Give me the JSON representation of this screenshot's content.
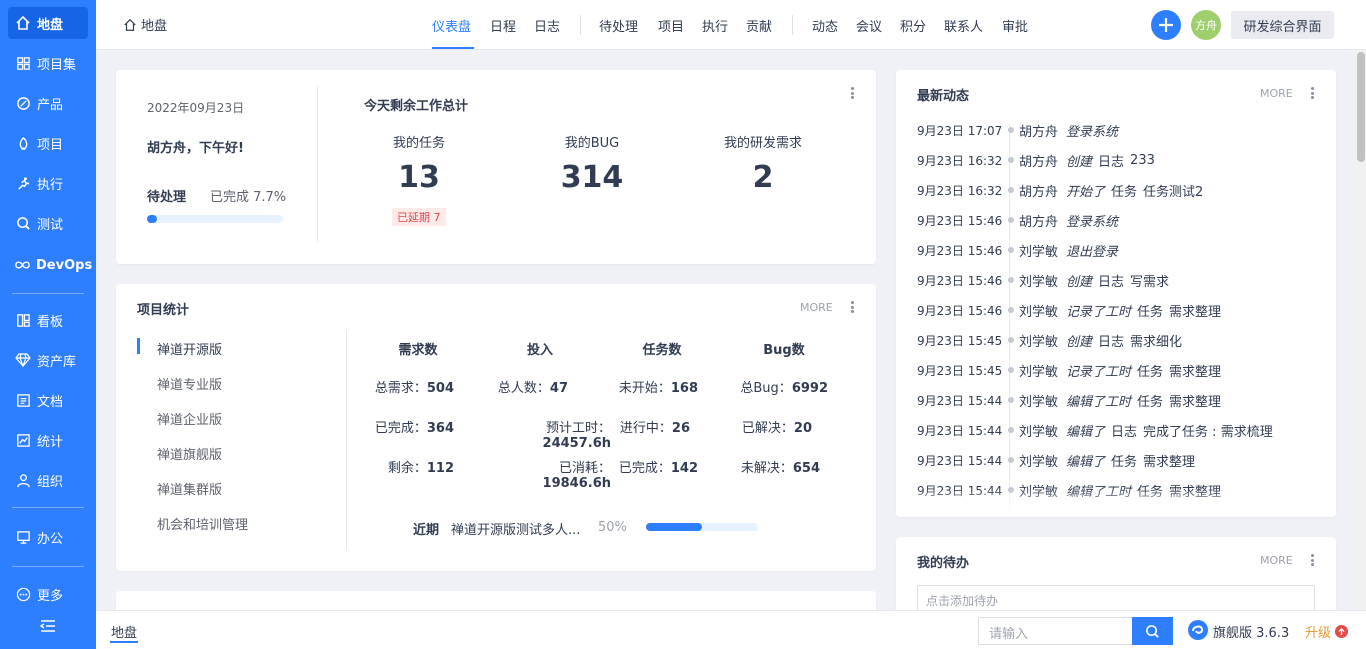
{
  "sidebar": {
    "items": [
      {
        "label": "地盘",
        "icon": "home-icon"
      },
      {
        "label": "项目集",
        "icon": "grid-icon"
      },
      {
        "label": "产品",
        "icon": "product-icon"
      },
      {
        "label": "项目",
        "icon": "project-icon"
      },
      {
        "label": "执行",
        "icon": "run-icon"
      },
      {
        "label": "测试",
        "icon": "test-icon"
      },
      {
        "label": "DevOps",
        "icon": "infinity-icon"
      },
      {
        "label": "看板",
        "icon": "kanban-icon"
      },
      {
        "label": "资产库",
        "icon": "diamond-icon"
      },
      {
        "label": "文档",
        "icon": "doc-icon"
      },
      {
        "label": "统计",
        "icon": "chart-icon"
      },
      {
        "label": "组织",
        "icon": "user-icon"
      },
      {
        "label": "办公",
        "icon": "office-icon"
      },
      {
        "label": "更多",
        "icon": "more-icon"
      }
    ]
  },
  "header": {
    "crumb": "地盘",
    "nav": [
      "仪表盘",
      "日程",
      "日志",
      "待处理",
      "项目",
      "执行",
      "贡献",
      "动态",
      "会议",
      "积分",
      "联系人",
      "审批"
    ],
    "avatar": "方舟",
    "ui_switch": "研发综合界面"
  },
  "welcome": {
    "date": "2022年09月23日",
    "greeting": "胡方舟，下午好!",
    "pending_label": "待处理",
    "done_label": "已完成 7.7%",
    "progress": 0.077,
    "summary_title": "今天剩余工作总计",
    "stats": [
      {
        "label": "我的任务",
        "value": "13"
      },
      {
        "label": "我的BUG",
        "value": "314"
      },
      {
        "label": "我的研发需求",
        "value": "2"
      }
    ],
    "delayed": "已延期 7"
  },
  "project_stats": {
    "title": "项目统计",
    "more": "MORE",
    "projects": [
      "禅道开源版",
      "禅道专业版",
      "禅道企业版",
      "禅道旗舰版",
      "禅道集群版",
      "机会和培训管理"
    ],
    "columns": [
      "需求数",
      "投入",
      "任务数",
      "Bug数"
    ],
    "rows": [
      [
        {
          "k": "总需求：",
          "v": "504"
        },
        {
          "k": "总人数：",
          "v": "47"
        },
        {
          "k": "未开始：",
          "v": "168"
        },
        {
          "k": "总Bug：",
          "v": "6992"
        }
      ],
      [
        {
          "k": "已完成：",
          "v": "364"
        },
        {
          "k": "预计工时：",
          "v": "24457.6h"
        },
        {
          "k": "进行中：",
          "v": "26"
        },
        {
          "k": "已解决：",
          "v": "20"
        }
      ],
      [
        {
          "k": "剩余：",
          "v": "112"
        },
        {
          "k": "已消耗：",
          "v": "19846.6h"
        },
        {
          "k": "已完成：",
          "v": "142"
        },
        {
          "k": "未解决：",
          "v": "654"
        }
      ]
    ],
    "recent_label": "近期",
    "recent_name": "禅道开源版测试多人...",
    "recent_pct": "50%",
    "recent_progress": 0.5
  },
  "dynamics": {
    "title": "最新动态",
    "more": "MORE",
    "rows": [
      {
        "time": "9月23日 17:07",
        "user": "胡方舟",
        "action": "登录系统",
        "type": "",
        "object": ""
      },
      {
        "time": "9月23日 16:32",
        "user": "胡方舟",
        "action": "创建",
        "type": "日志",
        "object": "233"
      },
      {
        "time": "9月23日 16:32",
        "user": "胡方舟",
        "action": "开始了",
        "type": "任务",
        "object": "任务测试2"
      },
      {
        "time": "9月23日 15:46",
        "user": "胡方舟",
        "action": "登录系统",
        "type": "",
        "object": ""
      },
      {
        "time": "9月23日 15:46",
        "user": "刘学敏",
        "action": "退出登录",
        "type": "",
        "object": ""
      },
      {
        "time": "9月23日 15:46",
        "user": "刘学敏",
        "action": "创建",
        "type": "日志",
        "object": "写需求"
      },
      {
        "time": "9月23日 15:46",
        "user": "刘学敏",
        "action": "记录了工时",
        "type": "任务",
        "object": "需求整理"
      },
      {
        "time": "9月23日 15:45",
        "user": "刘学敏",
        "action": "创建",
        "type": "日志",
        "object": "需求细化"
      },
      {
        "time": "9月23日 15:45",
        "user": "刘学敏",
        "action": "记录了工时",
        "type": "任务",
        "object": "需求整理"
      },
      {
        "time": "9月23日 15:44",
        "user": "刘学敏",
        "action": "编辑了工时",
        "type": "任务",
        "object": "需求整理"
      },
      {
        "time": "9月23日 15:44",
        "user": "刘学敏",
        "action": "编辑了",
        "type": "日志",
        "object": "完成了任务 : 需求梳理"
      },
      {
        "time": "9月23日 15:44",
        "user": "刘学敏",
        "action": "编辑了",
        "type": "任务",
        "object": "需求整理"
      },
      {
        "time": "9月23日 15:44",
        "user": "刘学敏",
        "action": "编辑了工时",
        "type": "任务",
        "object": "需求整理"
      }
    ]
  },
  "todo": {
    "title": "我的待办",
    "more": "MORE",
    "placeholder": "点击添加待办"
  },
  "footer": {
    "crumb": "地盘",
    "search_placeholder": "请输入",
    "version": "旗舰版 3.6.3",
    "upgrade": "升级"
  },
  "colors": {
    "accent": "#2e7fff",
    "sidebar": "#2e7fff",
    "danger": "#e54b4b",
    "upgrade": "#e89a39"
  }
}
